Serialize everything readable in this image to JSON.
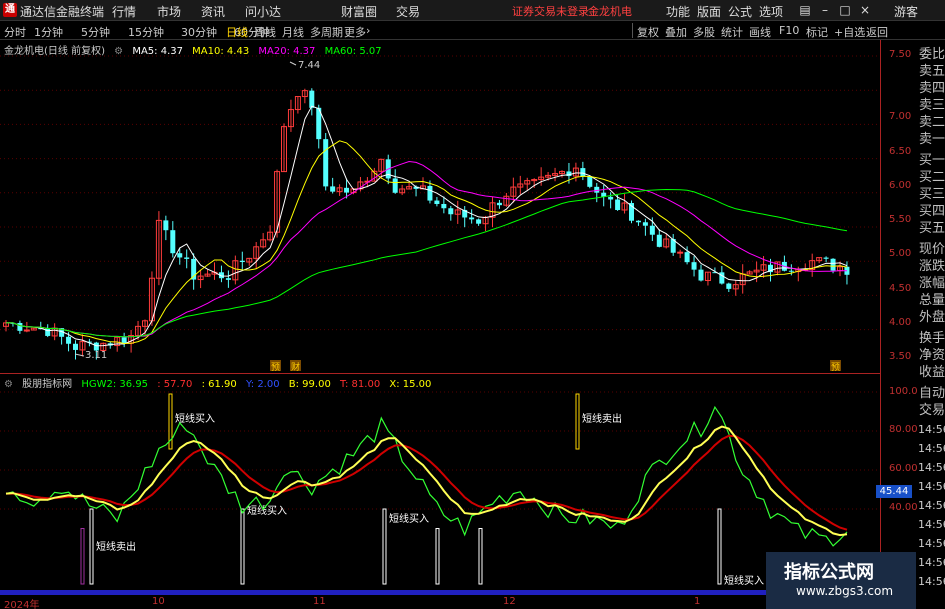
{
  "titlebar": {
    "app_name": "通达信金融终端",
    "menus": [
      "行情",
      "市场",
      "资讯",
      "问小达",
      "财富圈",
      "交易"
    ],
    "notice": "证券交易未登录",
    "stock_name": "金龙机电",
    "right_menus": [
      "功能",
      "版面",
      "公式",
      "选项"
    ],
    "guest": "游客"
  },
  "toolbar": {
    "timeframes": [
      "分时",
      "1分钟",
      "5分钟",
      "15分钟",
      "30分钟",
      "60分钟",
      "日线",
      "周线",
      "月线",
      "多周期",
      "更多"
    ],
    "active": "日线",
    "right_buttons": [
      "复权",
      "叠加",
      "多股",
      "统计",
      "画线",
      "F10",
      "标记",
      "+自选",
      "返回"
    ]
  },
  "main_info": {
    "title": "金龙机电(日线 前复权)",
    "ma5": "MA5: 4.37",
    "ma10": "MA10: 4.43",
    "ma20": "MA20: 4.37",
    "ma60": "MA60: 5.07"
  },
  "indicator_info": {
    "title": "股朋指标网",
    "hgw2": "HGW2: 36.95",
    "v1": ": 57.70",
    "v2": ": 61.90",
    "v3": "Y: 2.00",
    "v4": "B: 99.00",
    "v5": "T: 81.00",
    "v6": "X: 15.00"
  },
  "chart_data": {
    "type": "candlestick",
    "price_axis": [
      "7.50",
      "7.00",
      "6.50",
      "6.00",
      "5.50",
      "5.00",
      "4.50",
      "4.00",
      "3.50"
    ],
    "high_label": "7.44",
    "low_label": "3.11",
    "indicator_axis": [
      "100.0",
      "80.00",
      "60.00",
      "40.00"
    ],
    "indicator_current": "45.44",
    "time_labels": [
      "2024年",
      "10",
      "11",
      "12",
      "1"
    ],
    "signals": [
      {
        "text": "短线卖出"
      },
      {
        "text": "短线买入"
      },
      {
        "text": "短线买入"
      },
      {
        "text": "短线买入"
      },
      {
        "text": "短线卖出"
      },
      {
        "text": "短线买入"
      }
    ],
    "event_marks": [
      "预",
      "财",
      "预"
    ]
  },
  "right_panel": {
    "labels": [
      "委比",
      "卖五",
      "卖四",
      "卖三",
      "卖二",
      "卖一",
      "买一",
      "买二",
      "买三",
      "买四",
      "买五",
      "现价",
      "涨跌",
      "涨幅",
      "总量",
      "外盘",
      "换手",
      "净资",
      "收益",
      "自动",
      "交易"
    ],
    "times": [
      "14:56",
      "14:56",
      "14:56",
      "14:56",
      "14:56",
      "14:56",
      "14:56",
      "14:56",
      "14:56"
    ]
  },
  "watermark": {
    "title": "指标公式网",
    "url": "www.zbgs3.com"
  },
  "colors": {
    "up": "#ff3c3c",
    "down": "#54ffff",
    "ma5": "#ffffff",
    "ma10": "#ffff00",
    "ma20": "#ff00ff",
    "ma60": "#00ff00"
  }
}
